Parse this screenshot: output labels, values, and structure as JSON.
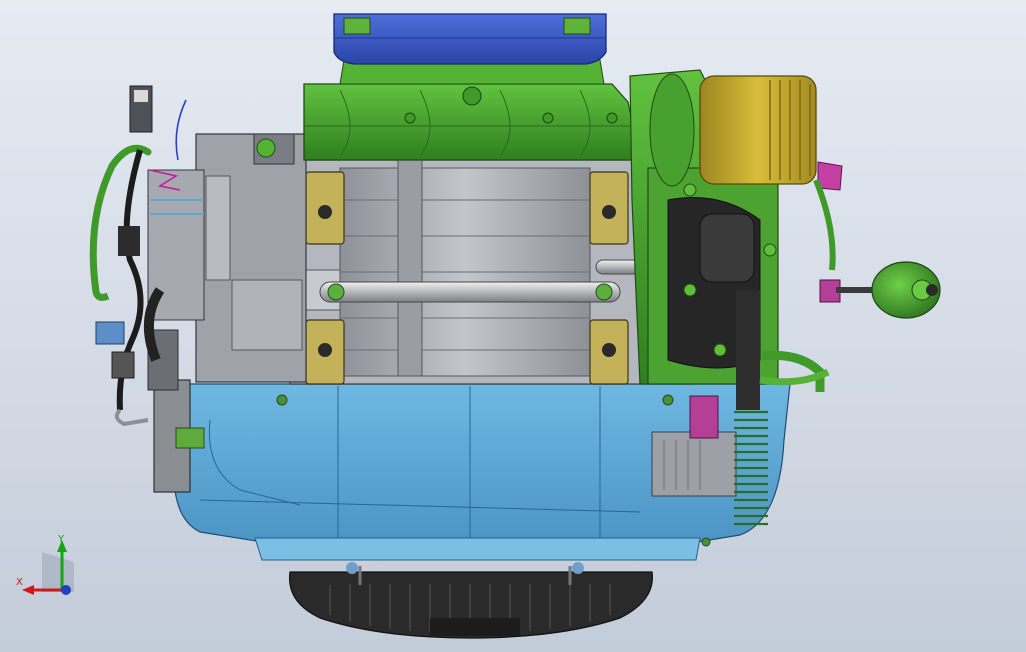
{
  "viewport": {
    "background_top": "#e6ebf2",
    "background_bottom": "#c3ccd9"
  },
  "model": {
    "view": "front",
    "render_style": "shaded-with-edges",
    "parts": [
      {
        "name": "air-cleaner-cover",
        "color": "#3b59c4"
      },
      {
        "name": "intake-manifold",
        "color": "#44a22c"
      },
      {
        "name": "cylinder-block",
        "color": "#a9acb3"
      },
      {
        "name": "cylinder-head-plates",
        "color": "#c4b25a"
      },
      {
        "name": "fuel-filter",
        "color": "#c7a92b"
      },
      {
        "name": "crankcase",
        "color": "#5fa9d6"
      },
      {
        "name": "flywheel-fan-guard",
        "color": "#262626"
      },
      {
        "name": "wiring-harness",
        "color": "#3f9a2a"
      },
      {
        "name": "connector",
        "color": "#b53f97"
      },
      {
        "name": "starter-bracket",
        "color": "#8a8d92"
      }
    ]
  },
  "triad": {
    "x_label": "X",
    "y_label": "Y",
    "x_color": "#d01818",
    "y_color": "#17a317",
    "z_color": "#2040c0"
  }
}
